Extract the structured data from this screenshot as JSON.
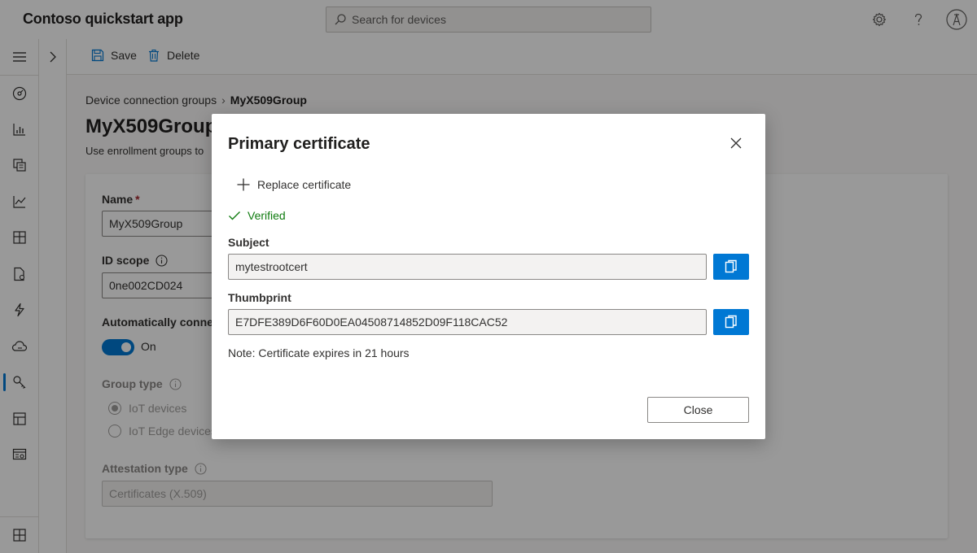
{
  "header": {
    "app_title": "Contoso quickstart app",
    "search_placeholder": "Search for devices",
    "icons": [
      "gear-icon",
      "help-icon",
      "account-icon"
    ]
  },
  "command_bar": {
    "save_label": "Save",
    "delete_label": "Delete"
  },
  "breadcrumb": {
    "parent": "Device connection groups",
    "current": "MyX509Group"
  },
  "page": {
    "title": "MyX509Group",
    "description": "Use enrollment groups to"
  },
  "form": {
    "name_label": "Name",
    "name_required": "*",
    "name_value": "MyX509Group",
    "id_scope_label": "ID scope",
    "id_scope_value": "0ne002CD024",
    "auto_connect_label": "Automatically connec",
    "auto_connect_state": "On",
    "group_type_label": "Group type",
    "group_type_options": [
      "IoT devices",
      "IoT Edge devices"
    ],
    "group_type_selected": "IoT devices",
    "attestation_label": "Attestation type",
    "attestation_value": "Certificates (X.509)"
  },
  "dialog": {
    "title": "Primary certificate",
    "replace_label": "Replace certificate",
    "verified_label": "Verified",
    "subject_label": "Subject",
    "subject_value": "mytestrootcert",
    "thumbprint_label": "Thumbprint",
    "thumbprint_value": "E7DFE389D6F60D0EA04508714852D09F118CAC52",
    "note": "Note: Certificate expires in 21 hours",
    "close_label": "Close"
  },
  "colors": {
    "accent": "#0078d4",
    "success": "#107c10",
    "overlay": "rgba(0,0,0,0.4)"
  }
}
